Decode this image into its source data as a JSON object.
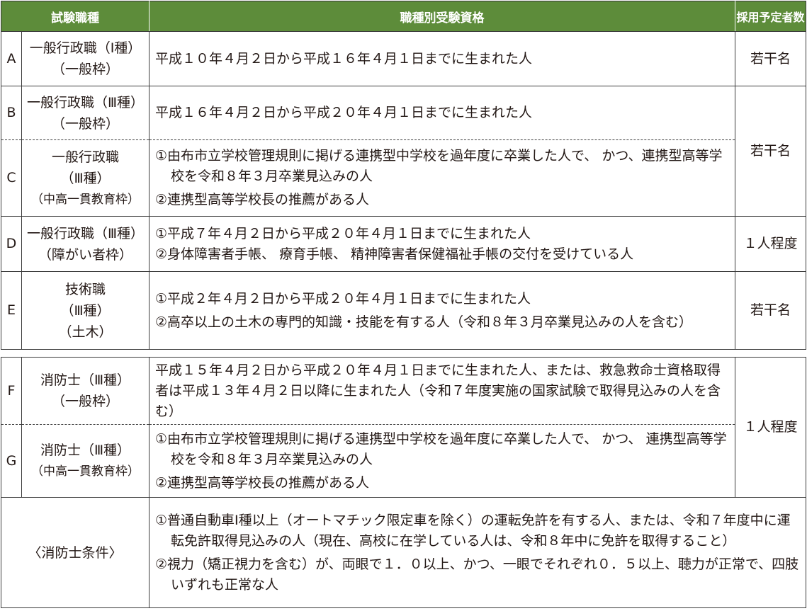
{
  "header": {
    "type_label": "試験職種",
    "qual_label": "職種別受験資格",
    "count_label": "採用予定者数"
  },
  "rows": [
    {
      "letter": "A",
      "name_lines": [
        "一般行政職（Ⅰ種）",
        "（一般枠）"
      ],
      "qualifications": [
        "平成１０年４月２日から平成１６年４月１日までに生まれた人"
      ],
      "count": "若干名"
    },
    {
      "letter": "B",
      "name_lines": [
        "一般行政職（Ⅲ種）",
        "（一般枠）"
      ],
      "qualifications": [
        "平成１６年４月２日から平成２０年４月１日までに生まれた人"
      ]
    },
    {
      "letter": "C",
      "name_lines": [
        "一般行政職",
        "（Ⅲ種）",
        "（中高一貫教育枠）"
      ],
      "qualifications": [
        "①由布市立学校管理規則に掲げる連携型中学校を過年度に卒業した人で、 かつ、連携型高等学校を令和８年３月卒業見込みの人",
        "②連携型高等学校長の推薦がある人"
      ]
    },
    {
      "letter": "D",
      "name_lines": [
        "一般行政職（Ⅲ種）",
        "（障がい者枠）"
      ],
      "qualifications": [
        "①平成７年４月２日から平成２０年４月１日までに生まれた人",
        "②身体障害者手帳、 療育手帳、 精神障害者保健福祉手帳の交付を受けている人"
      ],
      "count": "１人程度"
    },
    {
      "letter": "E",
      "name_lines": [
        "技術職",
        "（Ⅲ種）",
        "（土木）"
      ],
      "qualifications": [
        "①平成２年４月２日から平成２０年４月１日までに生まれた人",
        "②高卒以上の土木の専門的知識・技能を有する人（令和８年３月卒業見込みの人を含む）"
      ],
      "count": "若干名"
    }
  ],
  "bc_count": "若干名",
  "fire_rows": [
    {
      "letter": "F",
      "name_lines": [
        "消防士（Ⅲ種）",
        "（一般枠）"
      ],
      "qualifications": [
        "平成１５年４月２日から平成２０年４月１日までに生まれた人、または、救急救命士資格取得者は平成１３年４月２日以降に生まれた人（令和７年度実施の国家試験で取得見込みの人を含む）"
      ]
    },
    {
      "letter": "G",
      "name_lines": [
        "消防士（Ⅲ種）",
        "（中高一貫教育枠）"
      ],
      "qualifications": [
        "①由布市立学校管理規則に掲げる連携型中学校を過年度に卒業した人で、 かつ、 連携型高等学校を令和８年３月卒業見込みの人",
        "②連携型高等学校長の推薦がある人"
      ]
    }
  ],
  "fg_count": "１人程度",
  "conditions": {
    "label": "〈消防士条件〉",
    "items": [
      "①普通自動車Ⅰ種以上（オートマチック限定車を除く）の運転免許を有する人、または、令和７年度中に運転免許取得見込みの人（現在、高校に在学している人は、令和８年中に免許を取得すること）",
      "②視力（矯正視力を含む）が、両眼で１．０以上、かつ、一眼でそれぞれ０．５以上、聴力が正常で、四肢いずれも正常な人"
    ]
  },
  "colors": {
    "header_bg": "#5d8c3a",
    "header_text": "#ffffff",
    "border": "#3c3c3c"
  }
}
